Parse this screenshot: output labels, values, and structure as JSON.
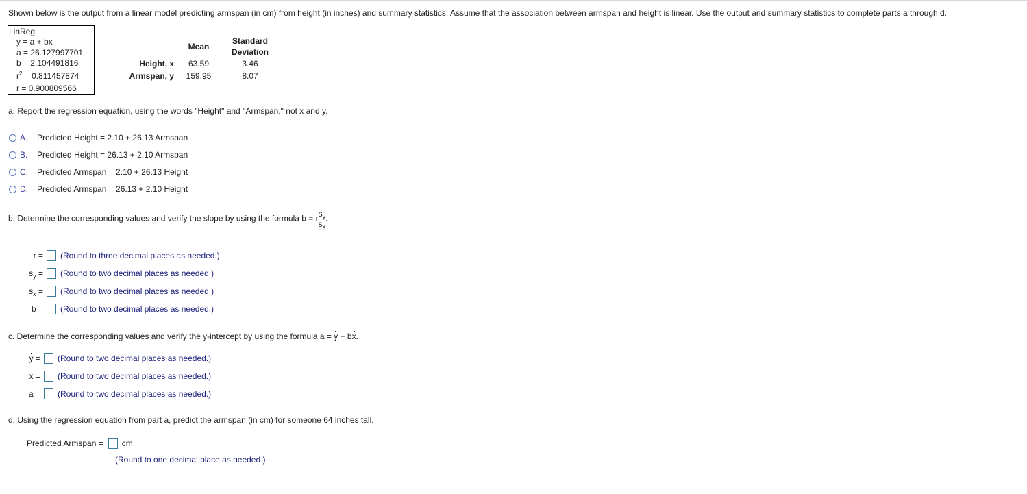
{
  "intro": "Shown below is the output from a linear model predicting armspan (in cm) from height (in inches) and summary statistics. Assume that the association between armspan and height is linear. Use the output and summary statistics to complete parts a through d.",
  "linreg": {
    "title": "LinReg",
    "equation": "y = a + bx",
    "a": "a = 26.127997701",
    "b": "b = 2.104491816",
    "r2_prefix": "r",
    "r2_sup": "2",
    "r2_value": " = 0.811457874",
    "r": "r = 0.900809566"
  },
  "stats_table": {
    "headers": [
      "Mean",
      "Standard",
      "Deviation"
    ],
    "rows": [
      {
        "label": "Height, x",
        "mean": "63.59",
        "sd": "3.46"
      },
      {
        "label": "Armspan, y",
        "mean": "159.95",
        "sd": "8.07"
      }
    ]
  },
  "part_a": {
    "question": "a. Report the regression equation, using the words \"Height\" and \"Armspan,\" not x and y.",
    "options": [
      {
        "letter": "A.",
        "text": "Predicted Height = 2.10 + 26.13 Armspan"
      },
      {
        "letter": "B.",
        "text": "Predicted Height = 26.13 + 2.10 Armspan"
      },
      {
        "letter": "C.",
        "text": "Predicted Armspan = 2.10 + 26.13 Height"
      },
      {
        "letter": "D.",
        "text": "Predicted Armspan = 26.13 + 2.10 Height"
      }
    ]
  },
  "part_b": {
    "question": "b. Determine the corresponding values and verify the slope by using the formula b = r",
    "frac_num": "s",
    "frac_num_sub": "y",
    "frac_den": "s",
    "frac_den_sub": "x",
    "period": ".",
    "rows": [
      {
        "label": "r =",
        "sub": "",
        "hint": "(Round to three decimal places as needed.)"
      },
      {
        "label": "s",
        "sub": "y",
        "suffix": " =",
        "hint": "(Round to two decimal places as needed.)"
      },
      {
        "label": "s",
        "sub": "x",
        "suffix": " =",
        "hint": "(Round to two decimal places as needed.)"
      },
      {
        "label": "b =",
        "sub": "",
        "hint": "(Round to two decimal places as needed.)"
      }
    ]
  },
  "part_c": {
    "question_prefix": "c. Determine the corresponding values and verify the y-intercept by using the formula a = ",
    "ybar": "y",
    "minus": " − b",
    "xbar": "x",
    "period": ".",
    "rows": [
      {
        "bar_var": "y",
        "eq": " =",
        "hint": "(Round to two decimal places as needed.)"
      },
      {
        "bar_var": "x",
        "eq": " =",
        "hint": "(Round to two decimal places as needed.)"
      },
      {
        "label": "a =",
        "hint": "(Round to two decimal places as needed.)"
      }
    ]
  },
  "part_d": {
    "question": "d. Using the regression equation from part a, predict the armspan (in cm) for someone 64 inches tall.",
    "label": "Predicted Armspan =",
    "unit": "cm",
    "hint": "(Round to one decimal place as needed.)"
  }
}
